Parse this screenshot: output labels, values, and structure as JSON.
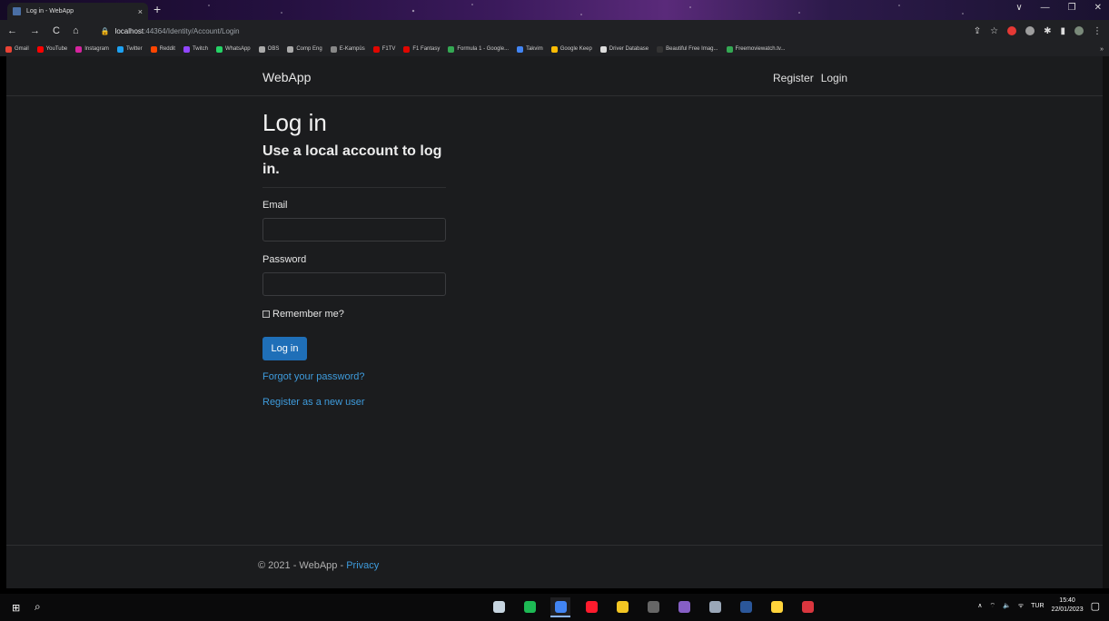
{
  "browser": {
    "tab_title": "Log in - WebApp",
    "tab_close": "×",
    "new_tab": "+",
    "window_controls": [
      "∨",
      "—",
      "❐",
      "✕"
    ],
    "nav_icons": [
      "←",
      "→",
      "C",
      "⌂"
    ],
    "url_host": "localhost",
    "url_path": ":44364/Identity/Account/Login",
    "bookmarks": [
      {
        "label": "Gmail",
        "color": "#ea4335"
      },
      {
        "label": "YouTube",
        "color": "#ff0000"
      },
      {
        "label": "Instagram",
        "color": "#d6249f"
      },
      {
        "label": "Twitter",
        "color": "#1da1f2"
      },
      {
        "label": "Reddit",
        "color": "#ff4500"
      },
      {
        "label": "Twitch",
        "color": "#9146ff"
      },
      {
        "label": "WhatsApp",
        "color": "#25d366"
      },
      {
        "label": "OBS",
        "color": "#aaaaaa"
      },
      {
        "label": "Comp Eng",
        "color": "#aaaaaa"
      },
      {
        "label": "E-Kampüs",
        "color": "#888888"
      },
      {
        "label": "F1TV",
        "color": "#e10600"
      },
      {
        "label": "F1 Fantasy",
        "color": "#e10600"
      },
      {
        "label": "Formula 1 - Google...",
        "color": "#34a853"
      },
      {
        "label": "Takvim",
        "color": "#4285f4"
      },
      {
        "label": "Google Keep",
        "color": "#fbbc04"
      },
      {
        "label": "Driver Database",
        "color": "#dddddd"
      },
      {
        "label": "Beautiful Free Imag...",
        "color": "#333333"
      },
      {
        "label": "Freemoviewatch.tv...",
        "color": "#34a853"
      }
    ],
    "bookmarks_more": "»"
  },
  "site": {
    "brand": "WebApp",
    "nav": {
      "register": "Register",
      "login": "Login"
    }
  },
  "login": {
    "title": "Log in",
    "subtitle": "Use a local account to log in.",
    "email_label": "Email",
    "email_value": "",
    "password_label": "Password",
    "password_value": "",
    "remember_label": "Remember me?",
    "submit_label": "Log in",
    "forgot_link": "Forgot your password?",
    "register_link": "Register as a new user"
  },
  "footer": {
    "copyright": "© 2021 - WebApp - ",
    "privacy": "Privacy"
  },
  "taskbar": {
    "apps": [
      {
        "name": "steam",
        "color": "#c7d5e0",
        "active": false
      },
      {
        "name": "spotify",
        "color": "#1db954",
        "active": false
      },
      {
        "name": "chrome",
        "color": "#4285f4",
        "active": true
      },
      {
        "name": "opera",
        "color": "#ff1b2d",
        "active": false
      },
      {
        "name": "file-explorer",
        "color": "#f3c623",
        "active": false
      },
      {
        "name": "terminal",
        "color": "#666666",
        "active": false
      },
      {
        "name": "visual-studio",
        "color": "#865fc5",
        "active": false
      },
      {
        "name": "app-blue",
        "color": "#9aa7b8",
        "active": false
      },
      {
        "name": "word",
        "color": "#2b579a",
        "active": false
      },
      {
        "name": "python",
        "color": "#ffd43b",
        "active": false
      },
      {
        "name": "app-red",
        "color": "#d9363e",
        "active": false
      }
    ],
    "language": "TUR",
    "time": "15:40",
    "date": "22/01/2023"
  }
}
